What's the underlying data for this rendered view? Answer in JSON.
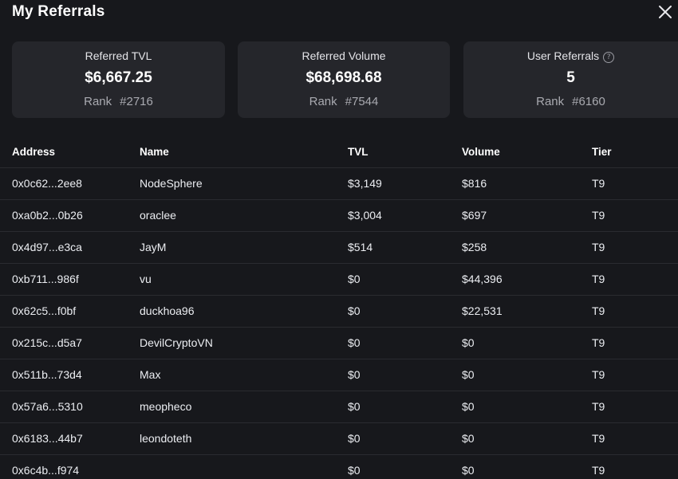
{
  "modal": {
    "title": "My Referrals",
    "close_icon": "close-icon"
  },
  "stats": [
    {
      "label": "Referred TVL",
      "value": "$6,667.25",
      "rank_label": "Rank",
      "rank_value": "#2716"
    },
    {
      "label": "Referred Volume",
      "value": "$68,698.68",
      "rank_label": "Rank",
      "rank_value": "#7544"
    },
    {
      "label": "User Referrals",
      "help_icon": "help-circle-icon",
      "help_glyph": "?",
      "value": "5",
      "rank_label": "Rank",
      "rank_value": "#6160"
    }
  ],
  "table": {
    "headers": {
      "address": "Address",
      "name": "Name",
      "tvl": "TVL",
      "volume": "Volume",
      "tier": "Tier"
    },
    "rows": [
      {
        "address": "0x0c62...2ee8",
        "name": "NodeSphere",
        "tvl": "$3,149",
        "volume": "$816",
        "tier": "T9"
      },
      {
        "address": "0xa0b2...0b26",
        "name": "oraclee",
        "tvl": "$3,004",
        "volume": "$697",
        "tier": "T9"
      },
      {
        "address": "0x4d97...e3ca",
        "name": "JayM",
        "tvl": "$514",
        "volume": "$258",
        "tier": "T9"
      },
      {
        "address": "0xb711...986f",
        "name": "vu",
        "tvl": "$0",
        "volume": "$44,396",
        "tier": "T9"
      },
      {
        "address": "0x62c5...f0bf",
        "name": "duckhoa96",
        "tvl": "$0",
        "volume": "$22,531",
        "tier": "T9"
      },
      {
        "address": "0x215c...d5a7",
        "name": "DevilCryptoVN",
        "tvl": "$0",
        "volume": "$0",
        "tier": "T9"
      },
      {
        "address": "0x511b...73d4",
        "name": "Max",
        "tvl": "$0",
        "volume": "$0",
        "tier": "T9"
      },
      {
        "address": "0x57a6...5310",
        "name": "meopheco",
        "tvl": "$0",
        "volume": "$0",
        "tier": "T9"
      },
      {
        "address": "0x6183...44b7",
        "name": "leondoteth",
        "tvl": "$0",
        "volume": "$0",
        "tier": "T9"
      },
      {
        "address": "0x6c4b...f974",
        "name": "",
        "tvl": "$0",
        "volume": "$0",
        "tier": "T9"
      }
    ]
  }
}
